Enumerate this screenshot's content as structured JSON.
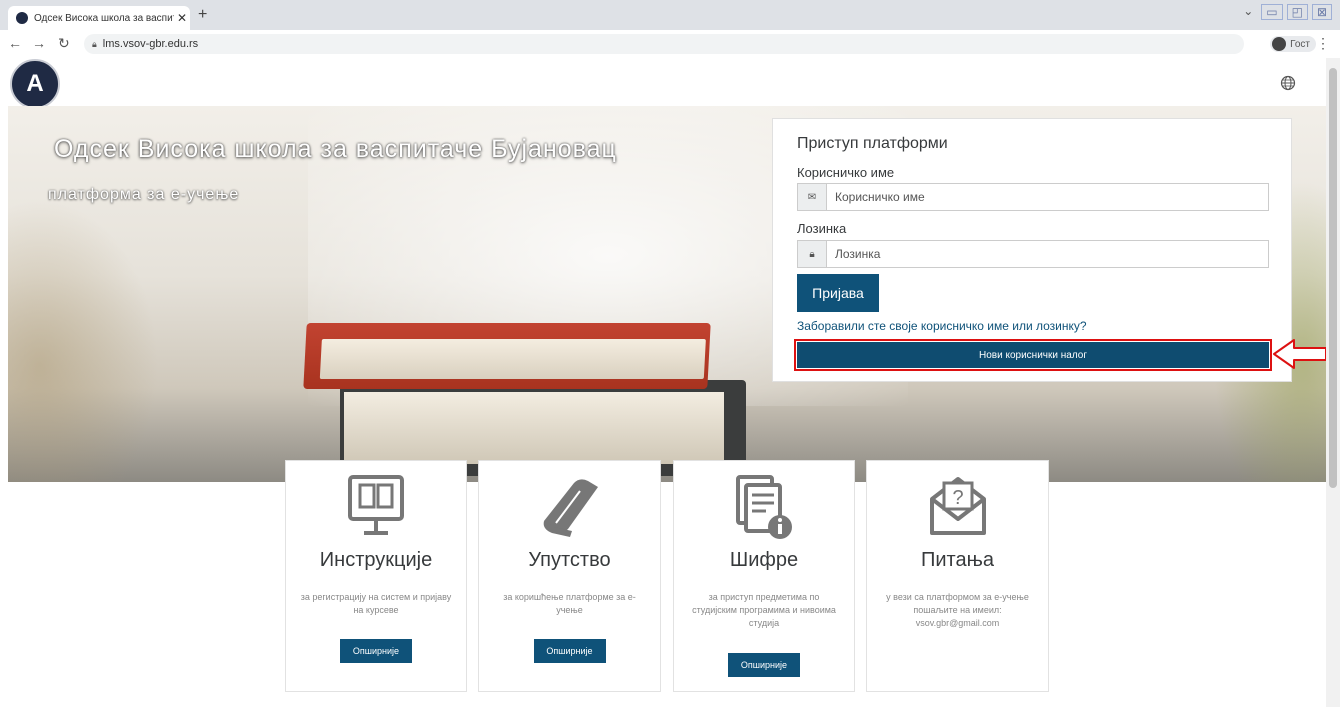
{
  "browser": {
    "tab_title": "Одсек Висока школа за васпита",
    "tab_close": "✕",
    "new_tab": "+",
    "url": "lms.vsov-gbr.edu.rs",
    "profile": "Гост"
  },
  "site": {
    "logo_text": "A"
  },
  "hero": {
    "title": "Одсек Висока школа за васпитаче Бујановац",
    "subtitle": "платформа за е-учење"
  },
  "login": {
    "title": "Приступ платформи",
    "username_label": "Корисничко име",
    "username_placeholder": "Корисничко име",
    "password_label": "Лозинка",
    "password_placeholder": "Лозинка",
    "submit": "Пријава",
    "forgot": "Заборавили сте своје корисничко име или лозинку?",
    "new_account": "Нови кориснички налог"
  },
  "cards": [
    {
      "title": "Инструкције",
      "desc": "за регистрацију на систем и пријаву на курсеве",
      "button": "Опширније"
    },
    {
      "title": "Упутство",
      "desc": "за коришћење платформе за е-учење",
      "button": "Опширније"
    },
    {
      "title": "Шифре",
      "desc": "за приступ предметима по студијским програмима и нивоима студија",
      "button": "Опширније"
    },
    {
      "title": "Питања",
      "desc": "у вези са платформом за е-учење пошаљите на имеил: vsov.gbr@gmail.com",
      "button": ""
    }
  ],
  "colors": {
    "primary": "#0f5279",
    "highlight": "#dd1111"
  }
}
